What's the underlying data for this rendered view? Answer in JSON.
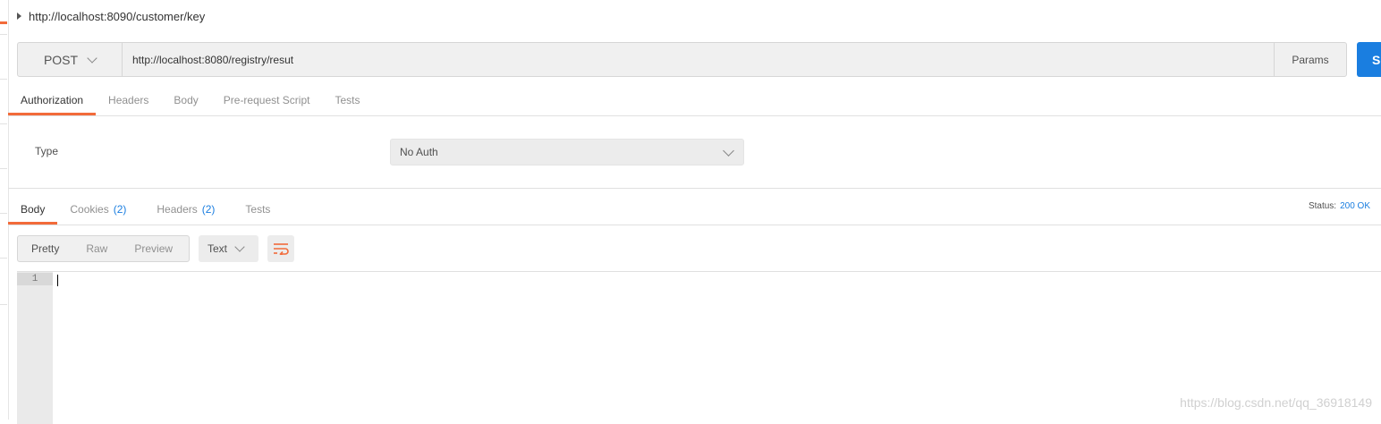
{
  "request": {
    "title": "http://localhost:8090/customer/key",
    "method": "POST",
    "url": "http://localhost:8080/registry/resut",
    "params_label": "Params",
    "send_label": "Se"
  },
  "request_tabs": [
    {
      "label": "Authorization",
      "active": true
    },
    {
      "label": "Headers",
      "active": false
    },
    {
      "label": "Body",
      "active": false
    },
    {
      "label": "Pre-request Script",
      "active": false
    },
    {
      "label": "Tests",
      "active": false
    }
  ],
  "auth": {
    "type_label": "Type",
    "selected": "No Auth"
  },
  "response_tabs": [
    {
      "label": "Body",
      "count": "",
      "active": true
    },
    {
      "label": "Cookies",
      "count": "(2)",
      "active": false
    },
    {
      "label": "Headers",
      "count": "(2)",
      "active": false
    },
    {
      "label": "Tests",
      "count": "",
      "active": false
    }
  ],
  "status": {
    "label": "Status:",
    "value": "200 OK"
  },
  "view_modes": [
    "Pretty",
    "Raw",
    "Preview"
  ],
  "format": "Text",
  "editor": {
    "line_number": "1"
  },
  "watermark": "https://blog.csdn.net/qq_36918149",
  "colors": {
    "accent": "#f26b3a",
    "primary": "#1a7ee0"
  },
  "icons": [
    "caret-right-icon",
    "chevron-down-icon",
    "wrap-lines-icon"
  ]
}
